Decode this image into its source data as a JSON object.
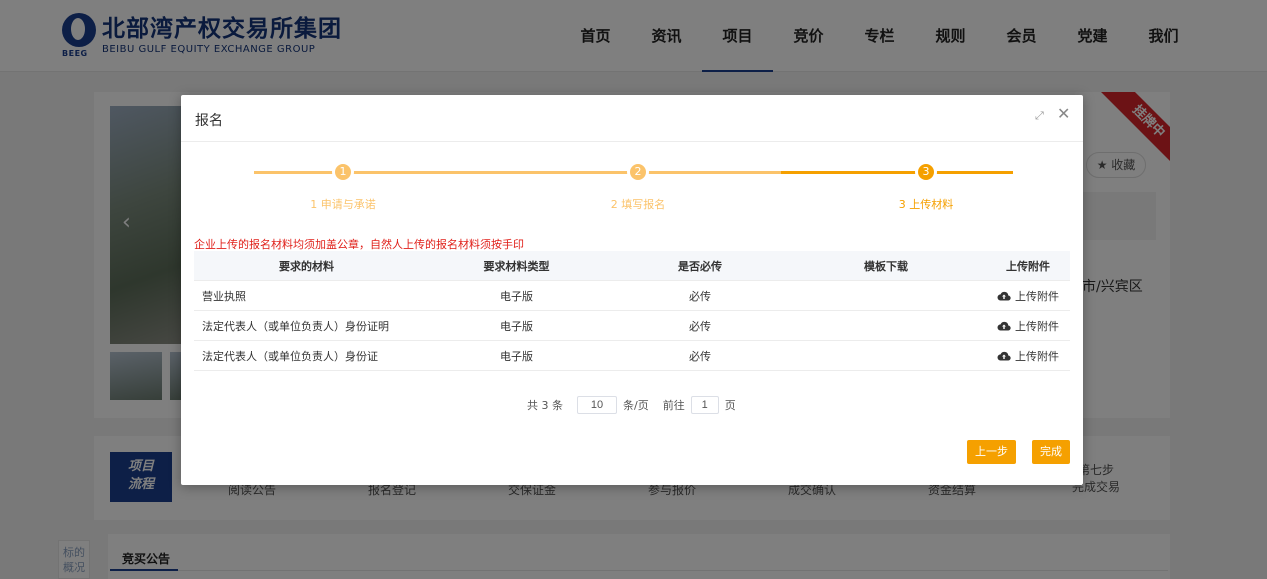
{
  "header": {
    "logo_cn": "北部湾产权交易所集团",
    "logo_en": "BEIBU GULF EQUITY EXCHANGE GROUP",
    "logo_abbr": "BEEG",
    "nav": [
      "首页",
      "资讯",
      "项目",
      "竞价",
      "专栏",
      "规则",
      "会员",
      "党建",
      "我们"
    ],
    "active_nav": "项目"
  },
  "listing": {
    "ribbon": "挂牌中",
    "favorite": "★ 收藏",
    "location_fragment": "市/兴宾区"
  },
  "flow": {
    "label_line1": "项目",
    "label_line2": "流程",
    "steps": [
      "阅读公告",
      "报名登记",
      "交保证金",
      "参与报价",
      "成交确认",
      "资金结算"
    ],
    "last_step_line1": "第七步",
    "last_step_line2": "完成交易"
  },
  "lower": {
    "side_tab": "标的概况",
    "tab": "竞买公告"
  },
  "modal": {
    "title": "报名",
    "steps": [
      {
        "num": "1",
        "label": "1 申请与承诺"
      },
      {
        "num": "2",
        "label": "2 填写报名"
      },
      {
        "num": "3",
        "label": "3 上传材料"
      }
    ],
    "active_step": 3,
    "colors": {
      "accent": "#f5a000",
      "accent_light": "#fbc36a",
      "notice": "#e0201a"
    },
    "notice": "企业上传的报名材料均须加盖公章，自然人上传的报名材料须按手印",
    "table": {
      "headers": [
        "要求的材料",
        "要求材料类型",
        "是否必传",
        "模板下载",
        "上传附件"
      ],
      "rows": [
        {
          "material": "营业执照",
          "type": "电子版",
          "required": "必传",
          "template": "",
          "upload": "上传附件"
        },
        {
          "material": "法定代表人（或单位负责人）身份证明",
          "type": "电子版",
          "required": "必传",
          "template": "",
          "upload": "上传附件"
        },
        {
          "material": "法定代表人（或单位负责人）身份证",
          "type": "电子版",
          "required": "必传",
          "template": "",
          "upload": "上传附件"
        }
      ]
    },
    "pagination": {
      "total": "共 3 条",
      "page_size": "10",
      "per_page": "条/页",
      "goto": "前往",
      "page": "1",
      "page_unit": "页"
    },
    "buttons": {
      "prev": "上一步",
      "finish": "完成"
    }
  }
}
